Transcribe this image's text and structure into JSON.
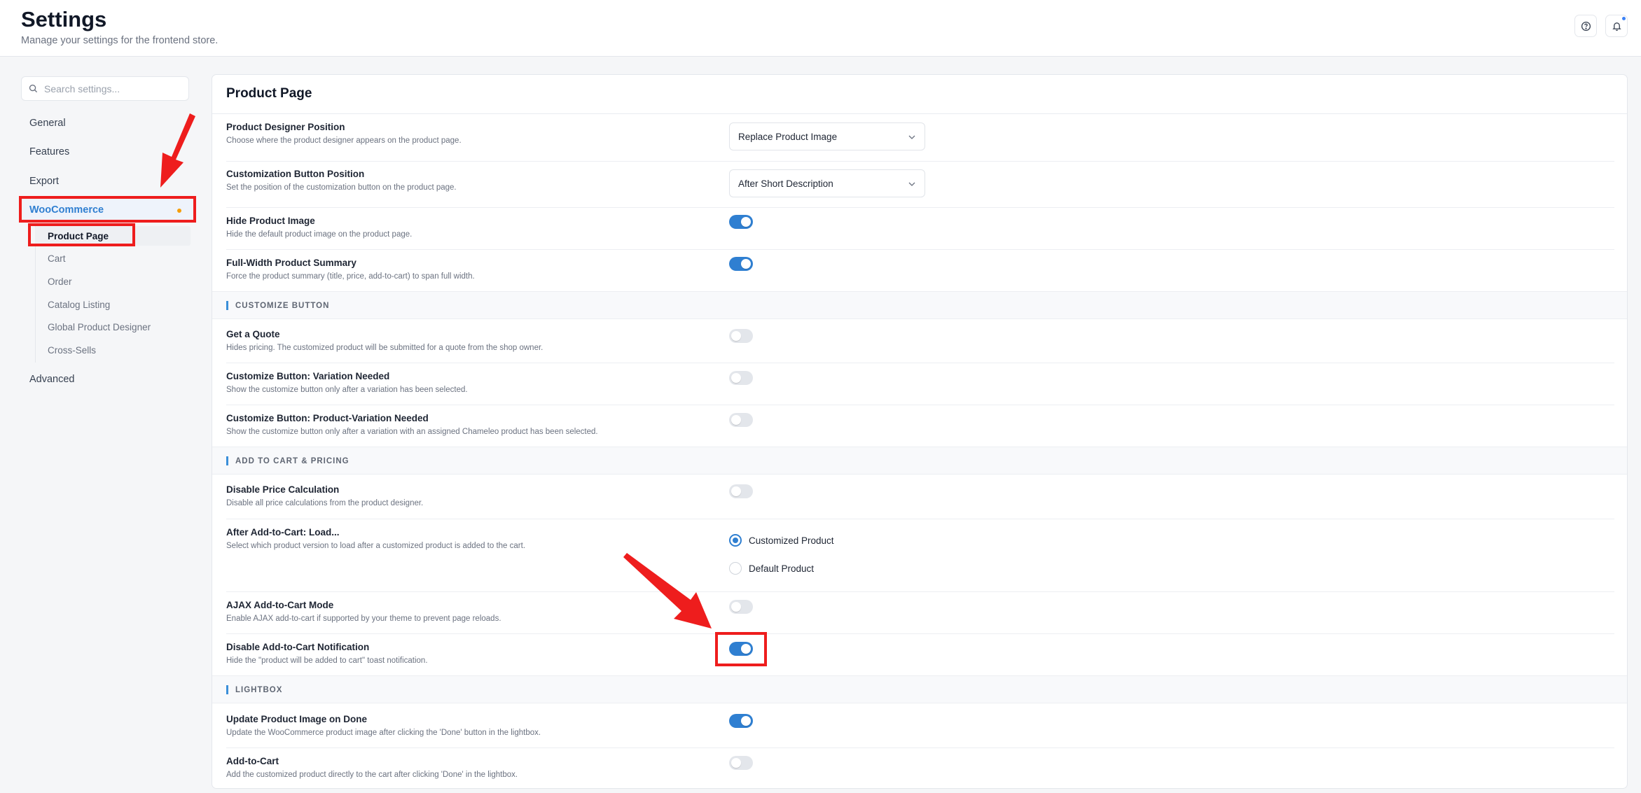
{
  "header": {
    "title": "Settings",
    "subtitle": "Manage your settings for the frontend store.",
    "icons": [
      "help-icon",
      "bell-icon"
    ]
  },
  "sidebar": {
    "search_placeholder": "Search settings...",
    "items": [
      {
        "label": "General"
      },
      {
        "label": "Features"
      },
      {
        "label": "Export"
      },
      {
        "label": "WooCommerce",
        "active": true
      },
      {
        "label": "Advanced"
      }
    ],
    "subitems": [
      {
        "label": "Product Page",
        "active": true
      },
      {
        "label": "Cart"
      },
      {
        "label": "Order"
      },
      {
        "label": "Catalog Listing"
      },
      {
        "label": "Global Product Designer"
      },
      {
        "label": "Cross-Sells"
      }
    ]
  },
  "panel": {
    "title": "Product Page",
    "settings": [
      {
        "label": "Product Designer Position",
        "description": "Choose where the product designer appears on the product page.",
        "control": "select",
        "value": "Replace Product Image"
      },
      {
        "label": "Customization Button Position",
        "description": "Set the position of the customization button on the product page.",
        "control": "select",
        "value": "After Short Description"
      },
      {
        "label": "Hide Product Image",
        "description": "Hide the default product image on the product page.",
        "control": "toggle",
        "on": true
      },
      {
        "label": "Full-Width Product Summary",
        "description": "Force the product summary (title, price, add-to-cart) to span full width.",
        "control": "toggle",
        "on": true
      }
    ],
    "sections": [
      {
        "title": "CUSTOMIZE BUTTON",
        "settings": [
          {
            "label": "Get a Quote",
            "description": "Hides pricing. The customized product will be submitted for a quote from the shop owner.",
            "control": "toggle",
            "on": false
          },
          {
            "label": "Customize Button: Variation Needed",
            "description": "Show the customize button only after a variation has been selected.",
            "control": "toggle",
            "on": false
          },
          {
            "label": "Customize Button: Product-Variation Needed",
            "description": "Show the customize button only after a variation with an assigned Chameleo product has been selected.",
            "control": "toggle",
            "on": false
          }
        ]
      },
      {
        "title": "ADD TO CART & PRICING",
        "settings": [
          {
            "label": "Disable Price Calculation",
            "description": "Disable all price calculations from the product designer.",
            "control": "toggle",
            "on": false
          },
          {
            "label": "After Add-to-Cart: Load...",
            "description": "Select which product version to load after a customized product is added to the cart.",
            "control": "radio",
            "options": [
              "Customized Product",
              "Default Product"
            ],
            "selected": "Customized Product"
          },
          {
            "label": "AJAX Add-to-Cart Mode",
            "description": "Enable AJAX add-to-cart if supported by your theme to prevent page reloads.",
            "control": "toggle",
            "on": false
          },
          {
            "label": "Disable Add-to-Cart Notification",
            "description": "Hide the \"product will be added to cart\" toast notification.",
            "control": "toggle",
            "on": true
          }
        ]
      },
      {
        "title": "LIGHTBOX",
        "settings": [
          {
            "label": "Update Product Image on Done",
            "description": "Update the WooCommerce product image after clicking the 'Done' button in the lightbox.",
            "control": "toggle",
            "on": true
          },
          {
            "label": "Add-to-Cart",
            "description": "Add the customized product directly to the cart after clicking 'Done' in the lightbox.",
            "control": "toggle",
            "on": false
          }
        ]
      }
    ]
  },
  "colors": {
    "accent": "#2f7fd1",
    "annotation": "#ee1d1d",
    "active_dot": "#f59e0b"
  }
}
